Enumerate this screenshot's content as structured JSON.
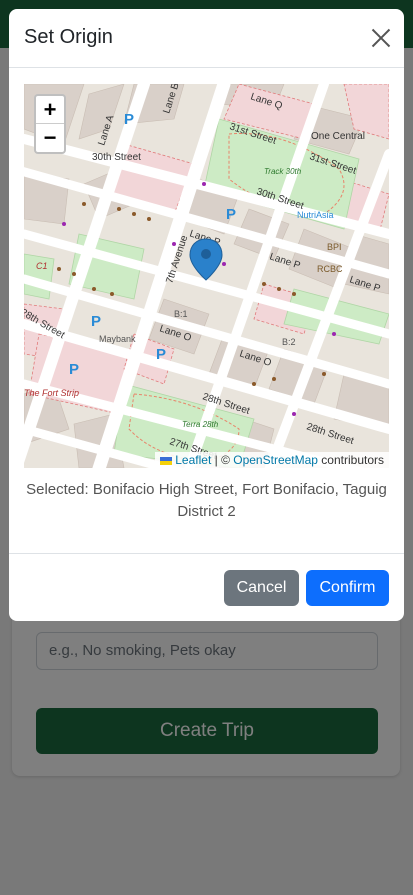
{
  "background": {
    "notes_placeholder": "e.g., No smoking, Pets okay",
    "create_trip_label": "Create Trip"
  },
  "modal": {
    "title": "Set Origin",
    "selected_text": "Selected: Bonifacio High Street, Fort Bonifacio, Taguig District 2",
    "cancel_label": "Cancel",
    "confirm_label": "Confirm"
  },
  "map": {
    "zoom_in": "+",
    "zoom_out": "−",
    "attribution_leaflet": "Leaflet",
    "attribution_sep": " | © ",
    "attribution_osm": "OpenStreetMap",
    "attribution_tail": " contributors",
    "labels": {
      "lane_q": "Lane Q",
      "31st_street_a": "31st Street",
      "31st_street_b": "31st Street",
      "one_central": "One Central",
      "30th_street_a": "30th Street",
      "30th_street_b": "30th Street",
      "track_30th": "Track 30th",
      "nutriasia": "NutriAsia",
      "bpi": "BPI",
      "rcbc": "RCBC",
      "lane_p_a": "Lane P",
      "lane_p_b": "Lane P",
      "lane_p_c": "Lane P",
      "7th_avenue": "7th Avenue",
      "lane_a": "Lane A",
      "lane_b": "Lane B",
      "lane_o_a": "Lane O",
      "lane_o_b": "Lane O",
      "maybank": "Maybank",
      "b1": "B:1",
      "b2": "B:2",
      "28th_street_a": "28th Street",
      "28th_street_b": "28th Street",
      "28th_street_c": "28th Street",
      "27th_street": "27th Street",
      "terra_28th": "Terra 28th",
      "the_fort_strip": "The Fort Strip",
      "c1": "C1"
    }
  },
  "colors": {
    "primary": "#0d6efd",
    "secondary": "#6c757d",
    "brand_green": "#1b6b3e",
    "marker": "#2a81cb"
  }
}
